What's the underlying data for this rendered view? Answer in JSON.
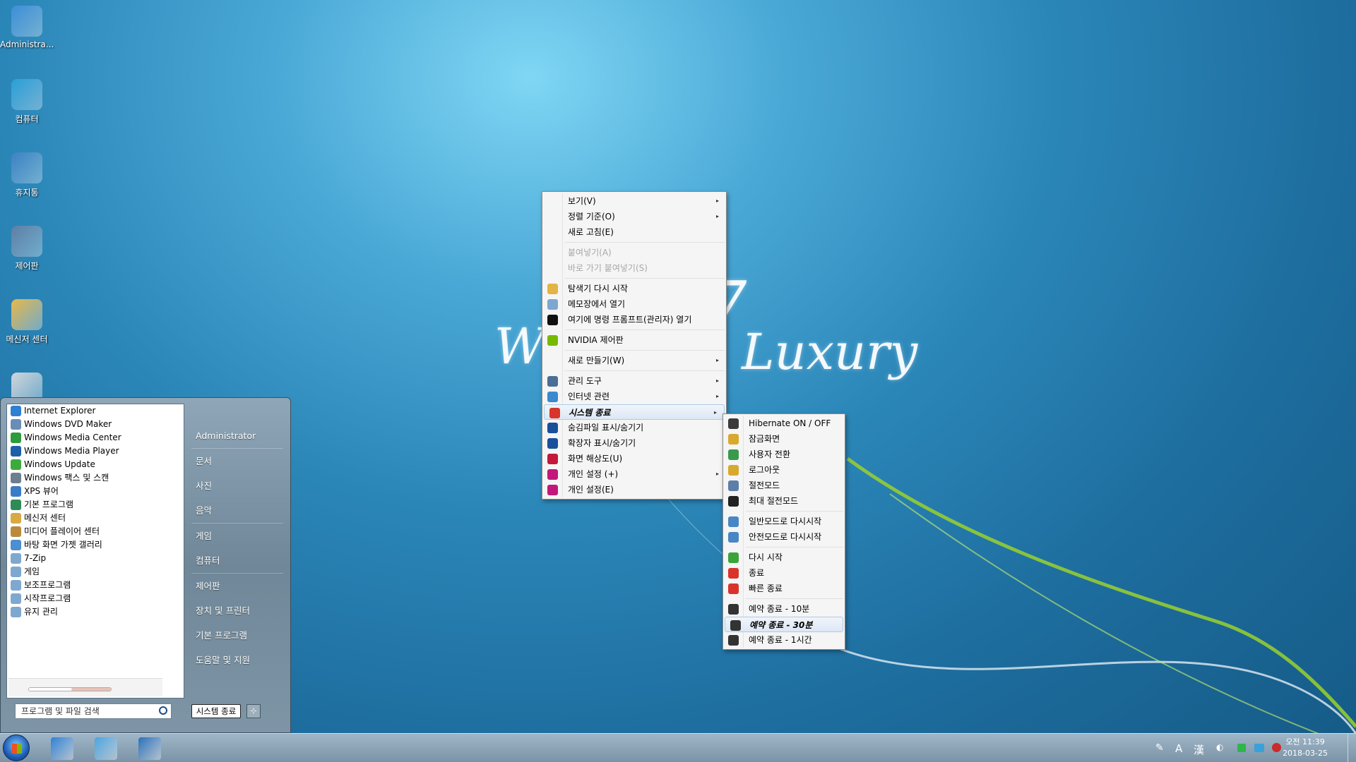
{
  "desktop": {
    "icons": [
      {
        "label": "Administra...",
        "icon": "user-folder-icon",
        "color": "#3d8ed8"
      },
      {
        "label": "컴퓨터",
        "icon": "computer-icon",
        "color": "#2a9fd8"
      },
      {
        "label": "휴지통",
        "icon": "recycle-bin-icon",
        "color": "#3b82c4"
      },
      {
        "label": "제어판",
        "icon": "control-panel-icon",
        "color": "#5d7fa3"
      },
      {
        "label": "메신저 센터",
        "icon": "messenger-folder-icon",
        "color": "#e7b84a"
      },
      {
        "label": "",
        "icon": "media-icon",
        "color": "#d0d6db"
      }
    ],
    "wallpaper_text": {
      "left": "W",
      "right": "Luxury",
      "seven": "7"
    }
  },
  "start_menu": {
    "programs": [
      {
        "label": "Internet Explorer",
        "icon": "ie-icon",
        "color": "#2f7fd3"
      },
      {
        "label": "Windows DVD Maker",
        "icon": "dvd-maker-icon",
        "color": "#6a8db5"
      },
      {
        "label": "Windows Media Center",
        "icon": "media-center-icon",
        "color": "#2b9b3b"
      },
      {
        "label": "Windows Media Player",
        "icon": "media-player-icon",
        "color": "#1d5fa8"
      },
      {
        "label": "Windows Update",
        "icon": "windows-update-icon",
        "color": "#3caa3c"
      },
      {
        "label": "Windows 팩스 및 스캔",
        "icon": "fax-scan-icon",
        "color": "#6d7f8e"
      },
      {
        "label": "XPS 뷰어",
        "icon": "xps-viewer-icon",
        "color": "#3b7cc8"
      },
      {
        "label": "기본 프로그램",
        "icon": "default-programs-icon",
        "color": "#2e8b57"
      },
      {
        "label": "메신저 센터",
        "icon": "messenger-center-icon",
        "color": "#d9a942"
      },
      {
        "label": "미디어 플레이어 센터",
        "icon": "media-player-center-icon",
        "color": "#b98a3e"
      },
      {
        "label": "바탕 화면 가젯 갤러리",
        "icon": "gadget-gallery-icon",
        "color": "#4a8fcf"
      },
      {
        "label": "7-Zip",
        "icon": "folder-icon",
        "color": "#7fa8d0"
      },
      {
        "label": "게임",
        "icon": "folder-icon",
        "color": "#7fa8d0"
      },
      {
        "label": "보조프로그램",
        "icon": "folder-icon",
        "color": "#7fa8d0"
      },
      {
        "label": "시작프로그램",
        "icon": "folder-icon",
        "color": "#7fa8d0"
      },
      {
        "label": "유지 관리",
        "icon": "folder-icon",
        "color": "#7fa8d0"
      }
    ],
    "search_placeholder": "프로그램 및 파일 검색",
    "right_items": [
      {
        "label": "Administrator",
        "sep_after": true
      },
      {
        "label": "문서",
        "sep_after": false
      },
      {
        "label": "사진",
        "sep_after": false
      },
      {
        "label": "음악",
        "sep_after": true
      },
      {
        "label": "게임",
        "sep_after": false
      },
      {
        "label": "컴퓨터",
        "sep_after": true
      },
      {
        "label": "제어판",
        "sep_after": false
      },
      {
        "label": "장치 및 프린터",
        "sep_after": false
      },
      {
        "label": "기본 프로그램",
        "sep_after": false
      },
      {
        "label": "도움말 및 지원",
        "sep_after": false
      }
    ],
    "shutdown_label": "시스템 종료",
    "shutdown_arrow": "⊹"
  },
  "context_menu": {
    "items": [
      {
        "label": "보기(V)",
        "submenu": true
      },
      {
        "label": "정렬 기준(O)",
        "submenu": true
      },
      {
        "label": "새로 고침(E)"
      },
      {
        "sep": true
      },
      {
        "label": "붙여넣기(A)",
        "disabled": true
      },
      {
        "label": "바로 가기 붙여넣기(S)",
        "disabled": true
      },
      {
        "sep": true
      },
      {
        "label": "탐색기 다시 시작",
        "icon": "explorer-icon",
        "color": "#e3b445"
      },
      {
        "label": "메모장에서 열기",
        "icon": "notepad-icon",
        "color": "#7ea7cf"
      },
      {
        "label": "여기에 명령 프롬프트(관리자) 열기",
        "icon": "cmd-icon",
        "color": "#111111"
      },
      {
        "sep": true
      },
      {
        "label": "NVIDIA 제어판",
        "icon": "nvidia-icon",
        "color": "#76b900"
      },
      {
        "sep": true
      },
      {
        "label": "새로 만들기(W)",
        "submenu": true
      },
      {
        "sep": true
      },
      {
        "label": "관리 도구",
        "icon": "admin-tools-icon",
        "color": "#4a6e95",
        "submenu": true
      },
      {
        "label": "인터넷 관련",
        "icon": "internet-icon",
        "color": "#3b89cf",
        "submenu": true
      },
      {
        "label": "시스템 종료",
        "icon": "power-icon",
        "color": "#d9342b",
        "submenu": true,
        "highlight": true
      },
      {
        "label": "숨김파일 표시/숨기기",
        "icon": "hidden-files-icon",
        "color": "#1a4f9c"
      },
      {
        "label": "확장자 표시/숨기기",
        "icon": "extensions-icon",
        "color": "#1a4f9c"
      },
      {
        "label": "화면 해상도(U)",
        "icon": "resolution-icon",
        "color": "#c3183c"
      },
      {
        "label": "개인 설정 (+)",
        "icon": "personalize-plus-icon",
        "color": "#c2187a",
        "submenu": true
      },
      {
        "label": "개인 설정(E)",
        "icon": "personalize-icon",
        "color": "#c2187a"
      }
    ]
  },
  "shutdown_submenu": {
    "items": [
      {
        "label": "Hibernate ON / OFF",
        "icon": "hibernate-icon",
        "color": "#3a3a3a"
      },
      {
        "label": "잠금화면",
        "icon": "lock-icon",
        "color": "#d9a82e"
      },
      {
        "label": "사용자 전환",
        "icon": "switch-user-icon",
        "color": "#3a9a4b"
      },
      {
        "label": "로그아웃",
        "icon": "logout-key-icon",
        "color": "#d9a82e"
      },
      {
        "label": "절전모드",
        "icon": "sleep-icon",
        "color": "#5d7ea8"
      },
      {
        "label": "최대 절전모드",
        "icon": "hibernate-moon-icon",
        "color": "#222222"
      },
      {
        "sep": true
      },
      {
        "label": "일반모드로 다시시작",
        "icon": "restart-normal-icon",
        "color": "#4a86c4"
      },
      {
        "label": "안전모드로 다시시작",
        "icon": "restart-safe-icon",
        "color": "#4a86c4"
      },
      {
        "sep": true
      },
      {
        "label": "다시 시작",
        "icon": "restart-icon",
        "color": "#3aa43a"
      },
      {
        "label": "종료",
        "icon": "shutdown-icon",
        "color": "#d9342b"
      },
      {
        "label": "빠른 종료",
        "icon": "fast-shutdown-icon",
        "color": "#d9342b"
      },
      {
        "sep": true
      },
      {
        "label": "예약 종료 - 10분",
        "icon": "timer-icon",
        "color": "#333333"
      },
      {
        "label": "예약 종료 - 30분",
        "icon": "timer-icon",
        "color": "#333333",
        "highlight": true
      },
      {
        "label": "예약 종료 - 1시간",
        "icon": "timer-icon",
        "color": "#333333"
      }
    ]
  },
  "taskbar": {
    "pinned": [
      {
        "name": "ie-taskbar-icon",
        "color": "#2f7fd3"
      },
      {
        "name": "libraries-taskbar-icon",
        "color": "#4aa3df"
      },
      {
        "name": "media-player-taskbar-icon",
        "color": "#2b6fb8"
      }
    ],
    "tray": {
      "ime_mode": "A",
      "hanja": "漢"
    },
    "clock_time": "오전 11:39",
    "clock_date": "2018-03-25"
  }
}
